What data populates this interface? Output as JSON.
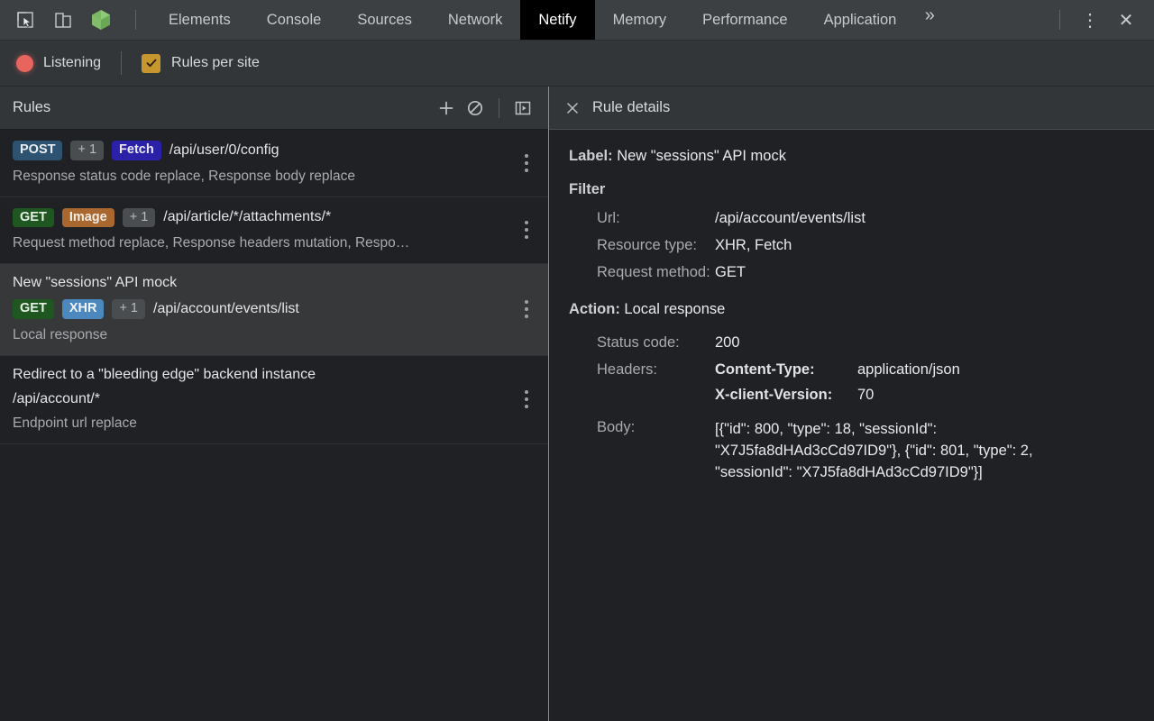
{
  "devtools": {
    "icons": {
      "inspect": "inspect-cursor-icon",
      "device": "device-toolbar-icon",
      "netify_logo": "netify-cube-logo"
    },
    "tabs": [
      {
        "label": "Elements",
        "active": false
      },
      {
        "label": "Console",
        "active": false
      },
      {
        "label": "Sources",
        "active": false
      },
      {
        "label": "Network",
        "active": false
      },
      {
        "label": "Netify",
        "active": true
      },
      {
        "label": "Memory",
        "active": false
      },
      {
        "label": "Performance",
        "active": false
      },
      {
        "label": "Application",
        "active": false
      }
    ],
    "overflow_label": "»",
    "menu_label": "⋮",
    "close_label": "✕"
  },
  "toolbar": {
    "listening_label": "Listening",
    "rules_per_site_label": "Rules per site",
    "rules_per_site_checked": true,
    "record_color": "#e8645f",
    "checkbox_color": "#c7972f"
  },
  "rules_panel": {
    "title": "Rules",
    "add_label": "+",
    "block_icon": "block-circle-slash-icon",
    "panel_toggle_icon": "show-details-panel-icon",
    "rules": [
      {
        "label": "",
        "badges": [
          {
            "text": "POST",
            "kind": "post"
          },
          {
            "text": "+ 1",
            "kind": "plus"
          },
          {
            "text": "Fetch",
            "kind": "fetch"
          }
        ],
        "url": "/api/user/0/config",
        "description": "Response status code replace, Response body replace",
        "selected": false
      },
      {
        "label": "",
        "badges": [
          {
            "text": "GET",
            "kind": "get"
          },
          {
            "text": "Image",
            "kind": "image"
          },
          {
            "text": "+ 1",
            "kind": "plus"
          }
        ],
        "url": "/api/article/*/attachments/*",
        "description": "Request method replace, Response headers mutation, Respo…",
        "selected": false
      },
      {
        "label": "New \"sessions\" API mock",
        "badges": [
          {
            "text": "GET",
            "kind": "get"
          },
          {
            "text": "XHR",
            "kind": "xhr"
          },
          {
            "text": "+ 1",
            "kind": "plus"
          }
        ],
        "url": "/api/account/events/list",
        "description": "Local response",
        "selected": true
      },
      {
        "label": "Redirect to a \"bleeding edge\" backend instance",
        "badges": [],
        "url": "/api/account/*",
        "description": "Endpoint url replace",
        "selected": false
      }
    ]
  },
  "details_panel": {
    "title": "Rule details",
    "close_label": "✕",
    "label_key": "Label:",
    "label_value": "New \"sessions\" API mock",
    "filter": {
      "title": "Filter",
      "rows": [
        {
          "key": "Url:",
          "value": "/api/account/events/list"
        },
        {
          "key": "Resource type:",
          "value": "XHR, Fetch"
        },
        {
          "key": "Request method:",
          "value": "GET"
        }
      ]
    },
    "action": {
      "key": "Action:",
      "value": "Local response",
      "status_key": "Status code:",
      "status_value": "200",
      "headers_key": "Headers:",
      "headers": [
        {
          "name": "Content-Type:",
          "value": "application/json"
        },
        {
          "name": "X-client-Version:",
          "value": "70"
        }
      ],
      "body_key": "Body:",
      "body_value": "[{\"id\": 800, \"type\": 18, \"sessionId\": \"X7J5fa8dHAd3cCd97ID9\"}, {\"id\": 801, \"type\": 2, \"sessionId\": \"X7J5fa8dHAd3cCd97ID9\"}]"
    }
  }
}
